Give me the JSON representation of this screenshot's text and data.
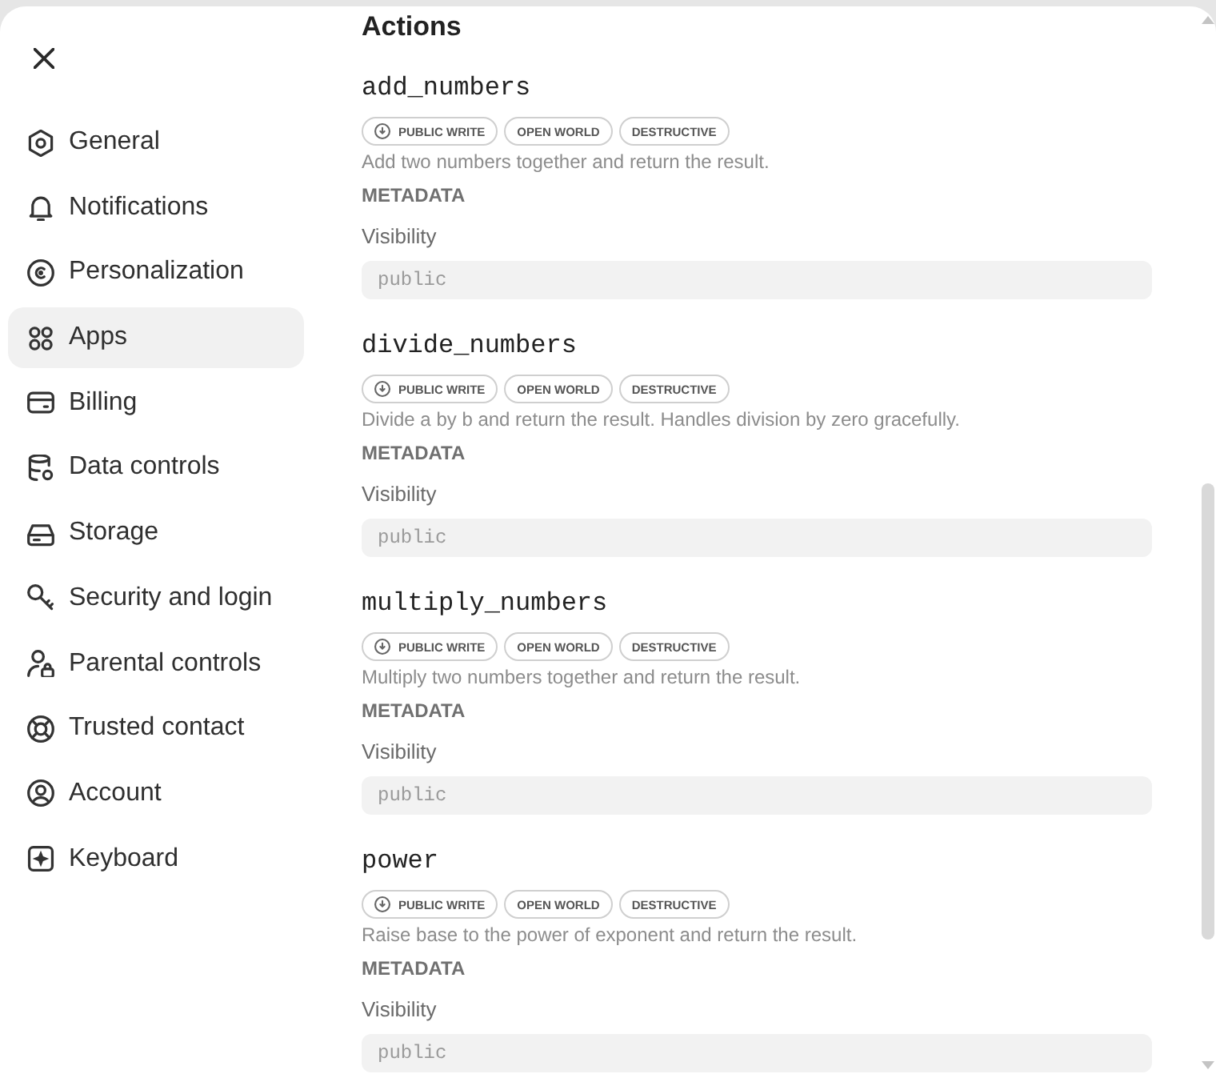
{
  "sidebar": {
    "items": [
      {
        "label": "General",
        "selected": false
      },
      {
        "label": "Notifications",
        "selected": false
      },
      {
        "label": "Personalization",
        "selected": false
      },
      {
        "label": "Apps",
        "selected": true
      },
      {
        "label": "Billing",
        "selected": false
      },
      {
        "label": "Data controls",
        "selected": false
      },
      {
        "label": "Storage",
        "selected": false
      },
      {
        "label": "Security and login",
        "selected": false
      },
      {
        "label": "Parental controls",
        "selected": false
      },
      {
        "label": "Trusted contact",
        "selected": false
      },
      {
        "label": "Account",
        "selected": false
      },
      {
        "label": "Keyboard",
        "selected": false
      }
    ]
  },
  "content": {
    "title": "Actions",
    "actions": [
      {
        "name": "add_numbers",
        "badges": [
          {
            "label": "PUBLIC WRITE",
            "kind": "icon"
          },
          {
            "label": "OPEN WORLD",
            "kind": "text"
          },
          {
            "label": "DESTRUCTIVE",
            "kind": "text"
          }
        ],
        "description": "Add two numbers together and return the result.",
        "metadata_label": "METADATA",
        "visibility": {
          "label": "Visibility",
          "value": "public",
          "disabled": true
        }
      },
      {
        "name": "divide_numbers",
        "badges": [
          {
            "label": "PUBLIC WRITE",
            "kind": "icon"
          },
          {
            "label": "OPEN WORLD",
            "kind": "text"
          },
          {
            "label": "DESTRUCTIVE",
            "kind": "text"
          }
        ],
        "description": "Divide a by b and return the result. Handles division by zero gracefully.",
        "metadata_label": "METADATA",
        "visibility": {
          "label": "Visibility",
          "value": "public",
          "disabled": true
        }
      },
      {
        "name": "multiply_numbers",
        "badges": [
          {
            "label": "PUBLIC WRITE",
            "kind": "icon"
          },
          {
            "label": "OPEN WORLD",
            "kind": "text"
          },
          {
            "label": "DESTRUCTIVE",
            "kind": "text"
          }
        ],
        "description": "Multiply two numbers together and return the result.",
        "metadata_label": "METADATA",
        "visibility": {
          "label": "Visibility",
          "value": "public",
          "disabled": true
        }
      },
      {
        "name": "power",
        "badges": [
          {
            "label": "PUBLIC WRITE",
            "kind": "icon"
          },
          {
            "label": "OPEN WORLD",
            "kind": "text"
          },
          {
            "label": "DESTRUCTIVE",
            "kind": "text"
          }
        ],
        "description": "Raise base to the power of exponent and return the result.",
        "metadata_label": "METADATA",
        "visibility": {
          "label": "Visibility",
          "value": "public",
          "disabled": true
        }
      }
    ]
  }
}
